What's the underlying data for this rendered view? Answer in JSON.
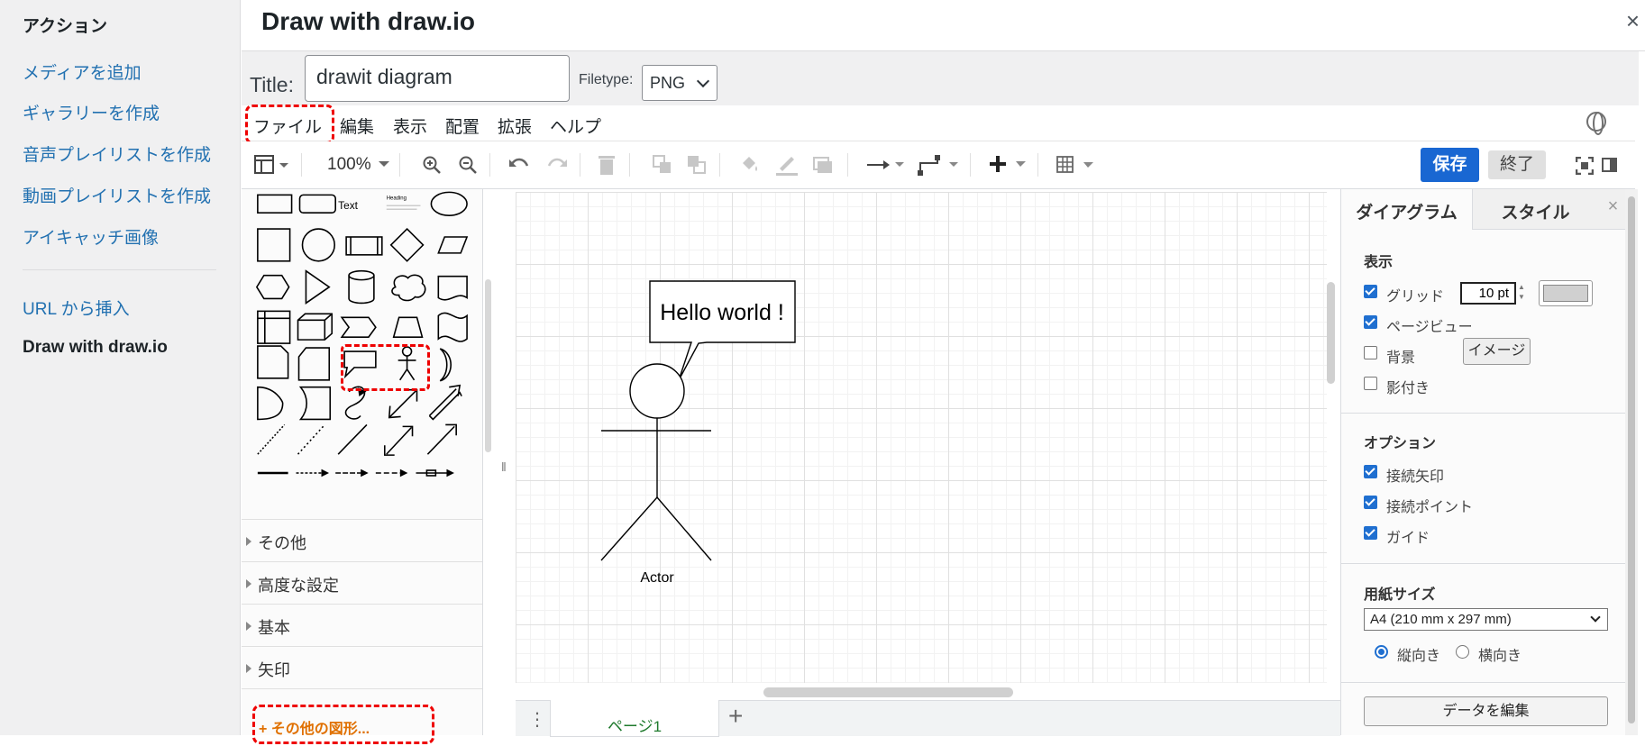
{
  "sidebar": {
    "heading": "アクション",
    "links": [
      "メディアを追加",
      "ギャラリーを作成",
      "音声プレイリストを作成",
      "動画プレイリストを作成",
      "アイキャッチ画像"
    ],
    "url_insert": "URL から挿入",
    "active": "Draw with draw.io"
  },
  "modal": {
    "title": "Draw with draw.io",
    "close": "×"
  },
  "title_row": {
    "label": "Title:",
    "value": "drawit diagram",
    "filetype_label": "Filetype:",
    "filetype_value": "PNG"
  },
  "menu": [
    "ファイル",
    "編集",
    "表示",
    "配置",
    "拡張",
    "ヘルプ"
  ],
  "toolbar": {
    "zoom": "100%",
    "save": "保存",
    "exit": "終了"
  },
  "shapes_panel": {
    "text_shape": "Text",
    "heading_shape": "Heading",
    "categories": [
      "その他",
      "高度な設定",
      "基本",
      "矢印"
    ],
    "more_shapes": "+ その他の図形..."
  },
  "canvas": {
    "callout_text": "Hello world !",
    "actor_label": "Actor",
    "page_tab": "ページ1"
  },
  "format_panel": {
    "tab_diagram": "ダイアグラム",
    "tab_style": "スタイル",
    "close": "×",
    "view_heading": "表示",
    "grid_label": "グリッド",
    "grid_size": "10 pt",
    "grid_color": "#d0d0d0",
    "pageview_label": "ページビュー",
    "background_label": "背景",
    "image_button": "イメージ",
    "shadow_label": "影付き",
    "options_heading": "オプション",
    "connection_arrows": "接続矢印",
    "connection_points": "接続ポイント",
    "guides": "ガイド",
    "paper_heading": "用紙サイズ",
    "paper_value": "A4 (210 mm x 297 mm)",
    "portrait": "縦向き",
    "landscape": "横向き",
    "edit_data": "データを編集"
  },
  "colors": {
    "accent": "#1967d2",
    "link": "#2271b1",
    "highlight": "#ee0000",
    "more_shapes": "#e07000"
  }
}
